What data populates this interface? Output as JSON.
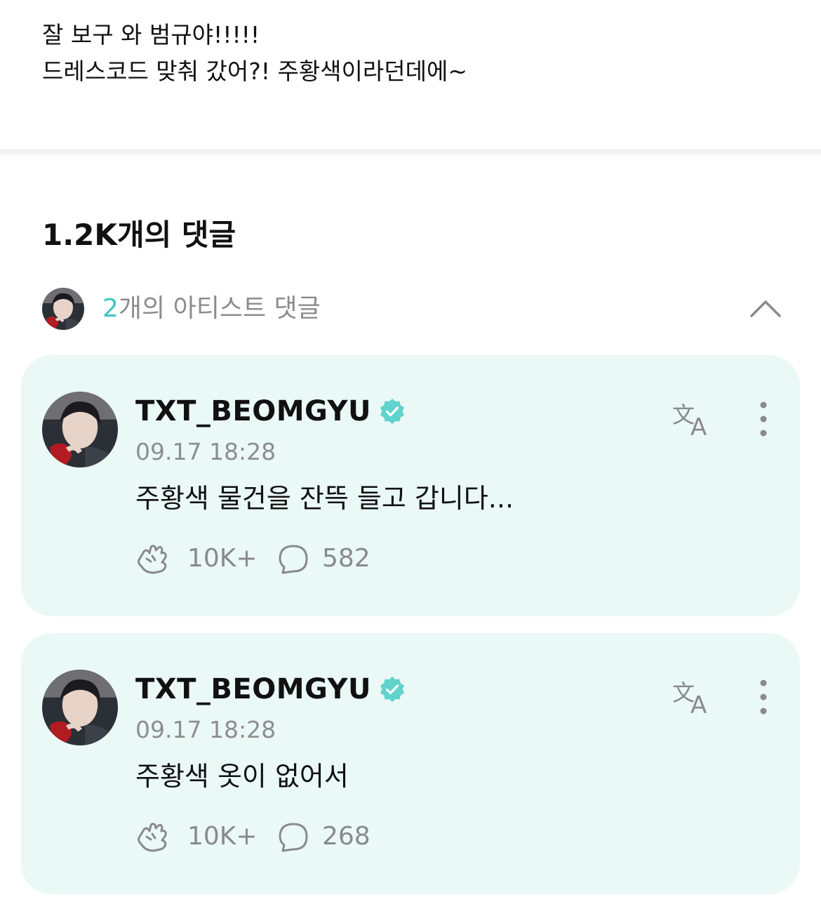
{
  "post": {
    "lines": [
      "잘 보구 와 범규야!!!!!",
      "드레스코드 맞춰 갔어?! 주황색이라던데에~"
    ]
  },
  "comments_header": {
    "title": "1.2K개의 댓글"
  },
  "artist_comments": {
    "count": "2",
    "label_suffix": "개의 아티스트 댓글",
    "toggle_icon": "chevron-up-icon",
    "items": [
      {
        "author": "TXT_BEOMGYU",
        "verified": true,
        "timestamp": "09.17 18:28",
        "text": "주황색 물건을 잔뜩 들고 갑니다...",
        "cheers": "10K+",
        "replies": "582"
      },
      {
        "author": "TXT_BEOMGYU",
        "verified": true,
        "timestamp": "09.17 18:28",
        "text": "주황색 옷이 없어서",
        "cheers": "10K+",
        "replies": "268"
      }
    ]
  },
  "icons": {
    "cheer": "cheer-hand-icon",
    "reply": "speech-bubble-icon",
    "translate": "translate-icon",
    "more": "more-vertical-icon",
    "verified": "verified-badge-icon"
  },
  "colors": {
    "accent": "#3fc7c0",
    "card_background": "#eaf9f6",
    "verified": "#5fd3cc",
    "muted_text": "#8c8c8c",
    "divider": "#f2f3f5"
  }
}
